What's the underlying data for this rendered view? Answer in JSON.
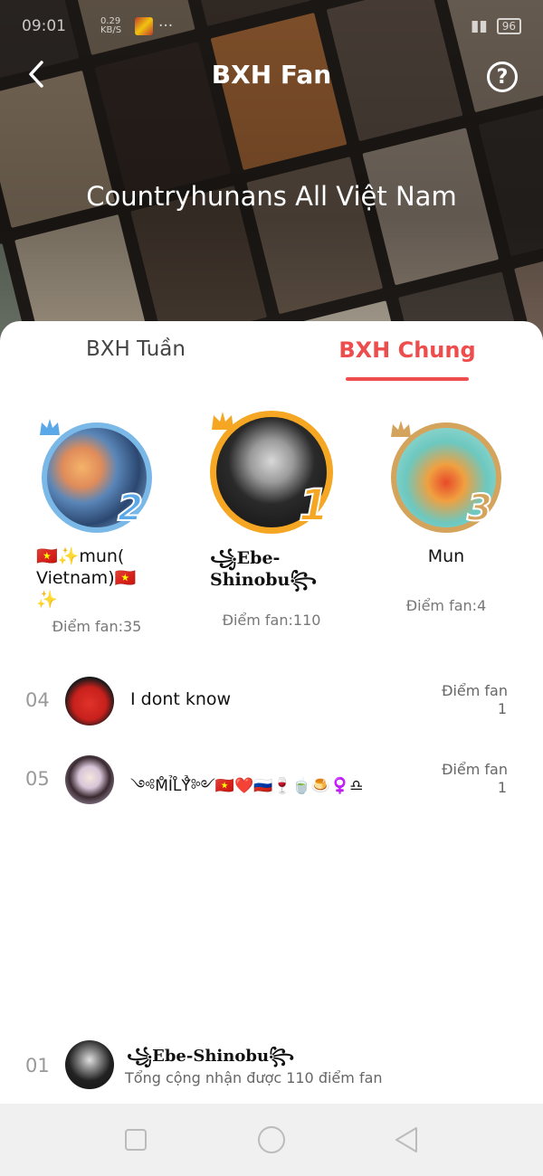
{
  "status_bar": {
    "time": "09:01",
    "data_speed": "0.29 KB/S",
    "battery": "96"
  },
  "header": {
    "title": "BXH Fan",
    "help_glyph": "?",
    "community_name": "Countryhunans All Việt Nam"
  },
  "tabs": {
    "week_label": "BXH Tuần",
    "all_label": "BXH Chung",
    "active": "all"
  },
  "podium": {
    "first": {
      "rank": "1",
      "name": "꧁Ebe-Shinobu꧂",
      "score": "Điểm fan:110"
    },
    "second": {
      "rank": "2",
      "name": "🇻🇳✨mun( Vietnam)🇻🇳✨",
      "score": "Điểm fan:35"
    },
    "third": {
      "rank": "3",
      "name": "Mun",
      "score": "Điểm fan:4"
    }
  },
  "rows": [
    {
      "rank": "04",
      "name": "I dont know",
      "fan_label": "Điểm fan",
      "fan_value": "1"
    },
    {
      "rank": "05",
      "name": "༺M̊ỈL̊Ỷ̊༻🇻🇳❤️🇷🇺🍷🍵🍮♀️♎",
      "fan_label": "Điểm fan",
      "fan_value": "1"
    }
  ],
  "my_rank": {
    "rank": "01",
    "name": "꧁Ebe-Shinobu꧂",
    "summary": "Tổng cộng nhận được 110 điểm fan"
  },
  "colors": {
    "accent": "#ee4d4d",
    "gold_ring": "#f5a623",
    "silver_ring": "#7ab8e8",
    "bronze_ring": "#d4a45c"
  },
  "icons": {
    "back": "chevron-left-icon",
    "help": "question-circle-icon",
    "nav_recent": "square-icon",
    "nav_home": "circle-icon",
    "nav_back": "triangle-back-icon"
  }
}
